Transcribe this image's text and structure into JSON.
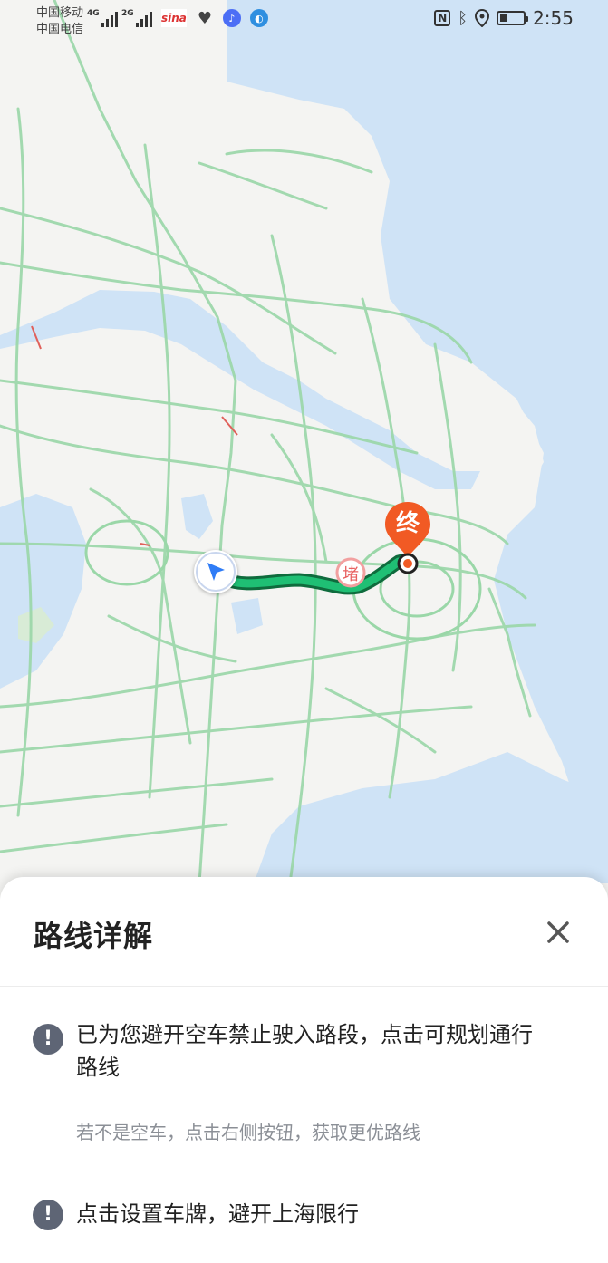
{
  "status_bar": {
    "carrier_1": "中国移动",
    "carrier_2": "中国电信",
    "net_1": "4G",
    "net_2": "2G",
    "app_1": "sina",
    "time": "2:55",
    "icons": [
      "nfc-icon",
      "bluetooth-icon",
      "location-icon",
      "battery-icon"
    ]
  },
  "map": {
    "start_marker_icon": "navigation-arrow-icon",
    "end_marker_label": "终",
    "via_marker_label": "堵",
    "colors": {
      "land": "#f4f4f2",
      "water": "#cfe3f6",
      "roads": "#9ad7a8",
      "route": "#1aa861",
      "end_marker": "#f15a24"
    }
  },
  "sheet": {
    "title": "路线详解",
    "close_icon": "close-icon",
    "items": [
      {
        "icon": "exclamation-icon",
        "text_line_1": "已为您避开空车禁止驶入路段，点击可规划通行",
        "text_line_2": "路线",
        "subtext": "若不是空车，点击右侧按钮，获取更优路线"
      },
      {
        "icon": "exclamation-icon",
        "text_line_1": "点击设置车牌，避开上海限行"
      }
    ]
  }
}
